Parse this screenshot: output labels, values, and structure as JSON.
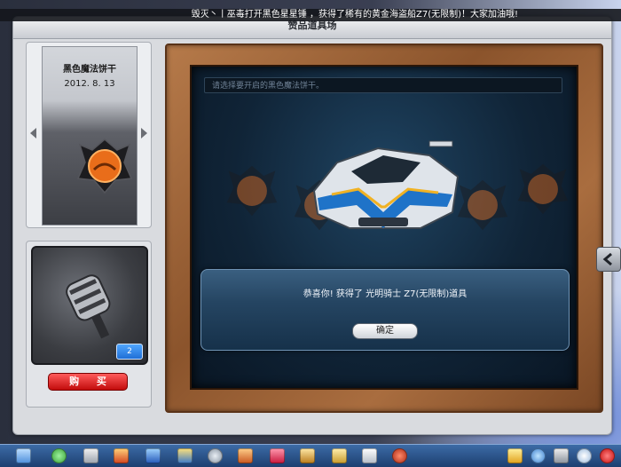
{
  "window": {
    "title": "赞品道具场"
  },
  "marquee": {
    "text": "毁灭丶丨巫毒打开黑色星星锤 ，获得了稀有的黄金海盗船Z7(无限制)！大家加油哦!"
  },
  "item_card": {
    "name": "黑色魔法饼干",
    "date": "2012. 8. 13"
  },
  "preview": {
    "count": "2"
  },
  "buy_button": {
    "label": "购 买"
  },
  "select_field": {
    "placeholder": "请选择要开启的黑色魔法饼干。"
  },
  "dialog": {
    "message": "恭喜你! 获得了 光明骑士 Z7(无限制)道具",
    "ok_label": "确定"
  },
  "colors": {
    "frame_wood": "#8b542c",
    "buy_red": "#c20c0c",
    "dialog_blue": "#254562",
    "taskbar_blue": "#1d3f70"
  },
  "icons": [
    "back-arrow-icon",
    "shopping-cart-icon",
    "person-icon",
    "bag-icon",
    "shoe-icon",
    "gear-icon",
    "gift-icon",
    "heart-icon",
    "tools-icon",
    "wrench-icon",
    "book-icon",
    "globe-icon",
    "star-icon",
    "flower-icon",
    "crossed-tools-icon",
    "search-icon",
    "power-icon"
  ]
}
